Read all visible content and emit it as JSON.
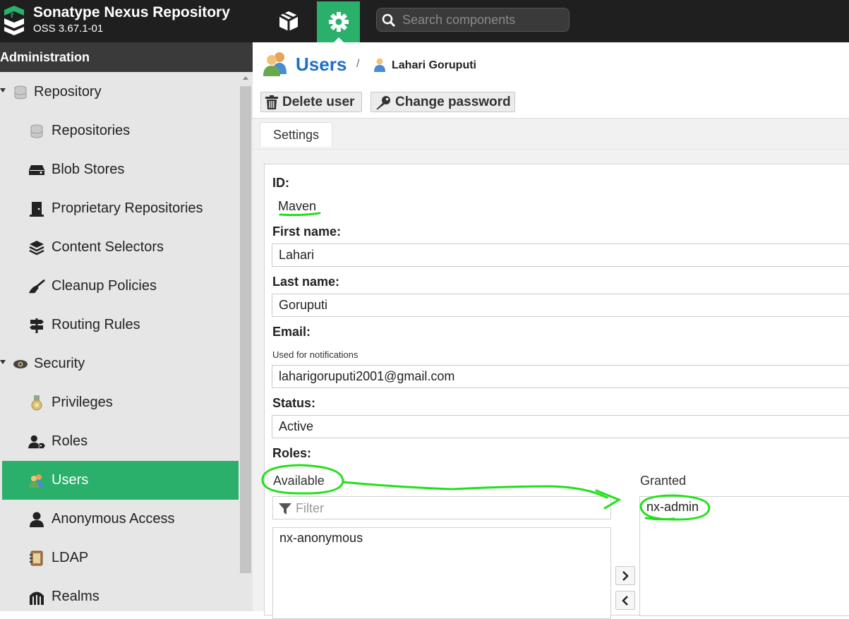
{
  "header": {
    "app_title": "Sonatype Nexus Repository",
    "app_version": "OSS 3.67.1-01",
    "browse_icon": "cube-icon",
    "admin_icon": "gear-icon",
    "search_placeholder": "Search components",
    "accent_color": "#2ab06a"
  },
  "sidebar": {
    "title": "Administration",
    "items": [
      {
        "label": "Repository",
        "icon": "database-icon",
        "level": 0
      },
      {
        "label": "Repositories",
        "icon": "database-icon",
        "level": 1
      },
      {
        "label": "Blob Stores",
        "icon": "hard-drive-icon",
        "level": 1
      },
      {
        "label": "Proprietary Repositories",
        "icon": "door-icon",
        "level": 1
      },
      {
        "label": "Content Selectors",
        "icon": "layers-icon",
        "level": 1
      },
      {
        "label": "Cleanup Policies",
        "icon": "broom-icon",
        "level": 1
      },
      {
        "label": "Routing Rules",
        "icon": "signpost-icon",
        "level": 1
      },
      {
        "label": "Security",
        "icon": "eye-icon",
        "level": 0
      },
      {
        "label": "Privileges",
        "icon": "medal-icon",
        "level": 1
      },
      {
        "label": "Roles",
        "icon": "user-tag-icon",
        "level": 1
      },
      {
        "label": "Users",
        "icon": "users-icon",
        "level": 1,
        "selected": true
      },
      {
        "label": "Anonymous Access",
        "icon": "user-icon",
        "level": 1
      },
      {
        "label": "LDAP",
        "icon": "address-book-icon",
        "level": 1
      },
      {
        "label": "Realms",
        "icon": "gate-icon",
        "level": 1
      }
    ]
  },
  "breadcrumb": {
    "section": "Users",
    "separator": "/",
    "current": "Lahari Goruputi"
  },
  "toolbar": {
    "delete_label": "Delete user",
    "change_password_label": "Change password"
  },
  "tabs": {
    "settings": "Settings"
  },
  "form": {
    "id_label": "ID:",
    "id_value": "Maven",
    "first_name_label": "First name:",
    "first_name_value": "Lahari",
    "last_name_label": "Last name:",
    "last_name_value": "Goruputi",
    "email_label": "Email:",
    "email_help": "Used for notifications",
    "email_value": "laharigoruputi2001@gmail.com",
    "status_label": "Status:",
    "status_value": "Active",
    "roles_label": "Roles:",
    "available_label": "Available",
    "granted_label": "Granted",
    "filter_placeholder": "Filter",
    "available_roles": [
      "nx-anonymous"
    ],
    "granted_roles": [
      "nx-admin"
    ]
  },
  "annotation_color": "#22e01a"
}
